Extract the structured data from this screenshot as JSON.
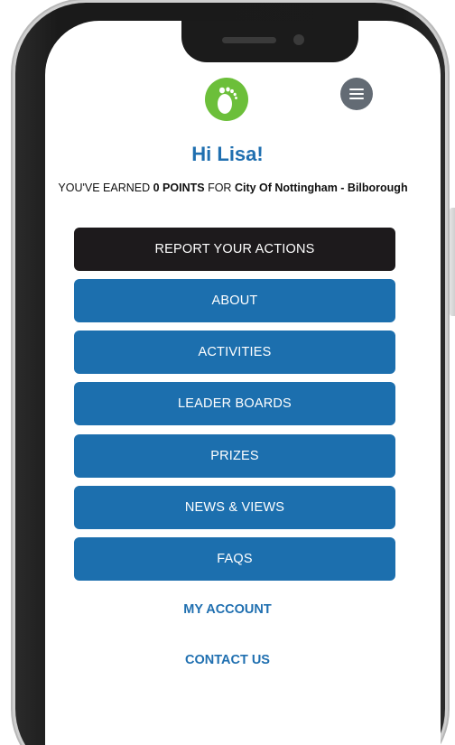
{
  "header": {
    "greeting": "Hi Lisa!",
    "points_prefix": "YOU'VE EARNED ",
    "points_value": "0 POINTS",
    "points_mid": " FOR ",
    "location": "City Of Nottingham - Bilborough"
  },
  "buttons": {
    "report": "REPORT YOUR ACTIONS",
    "about": "ABOUT",
    "activities": "ACTIVITIES",
    "leader_boards": "LEADER BOARDS",
    "prizes": "PRIZES",
    "news_views": "NEWS & VIEWS",
    "faqs": "FAQS"
  },
  "links": {
    "my_account": "MY ACCOUNT",
    "contact_us": "CONTACT US"
  },
  "icons": {
    "logo": "footprint-icon",
    "menu": "hamburger-menu-icon"
  },
  "colors": {
    "brand_blue": "#1c6fae",
    "logo_green": "#6cbf3a",
    "dark_button": "#1d1a1c"
  }
}
